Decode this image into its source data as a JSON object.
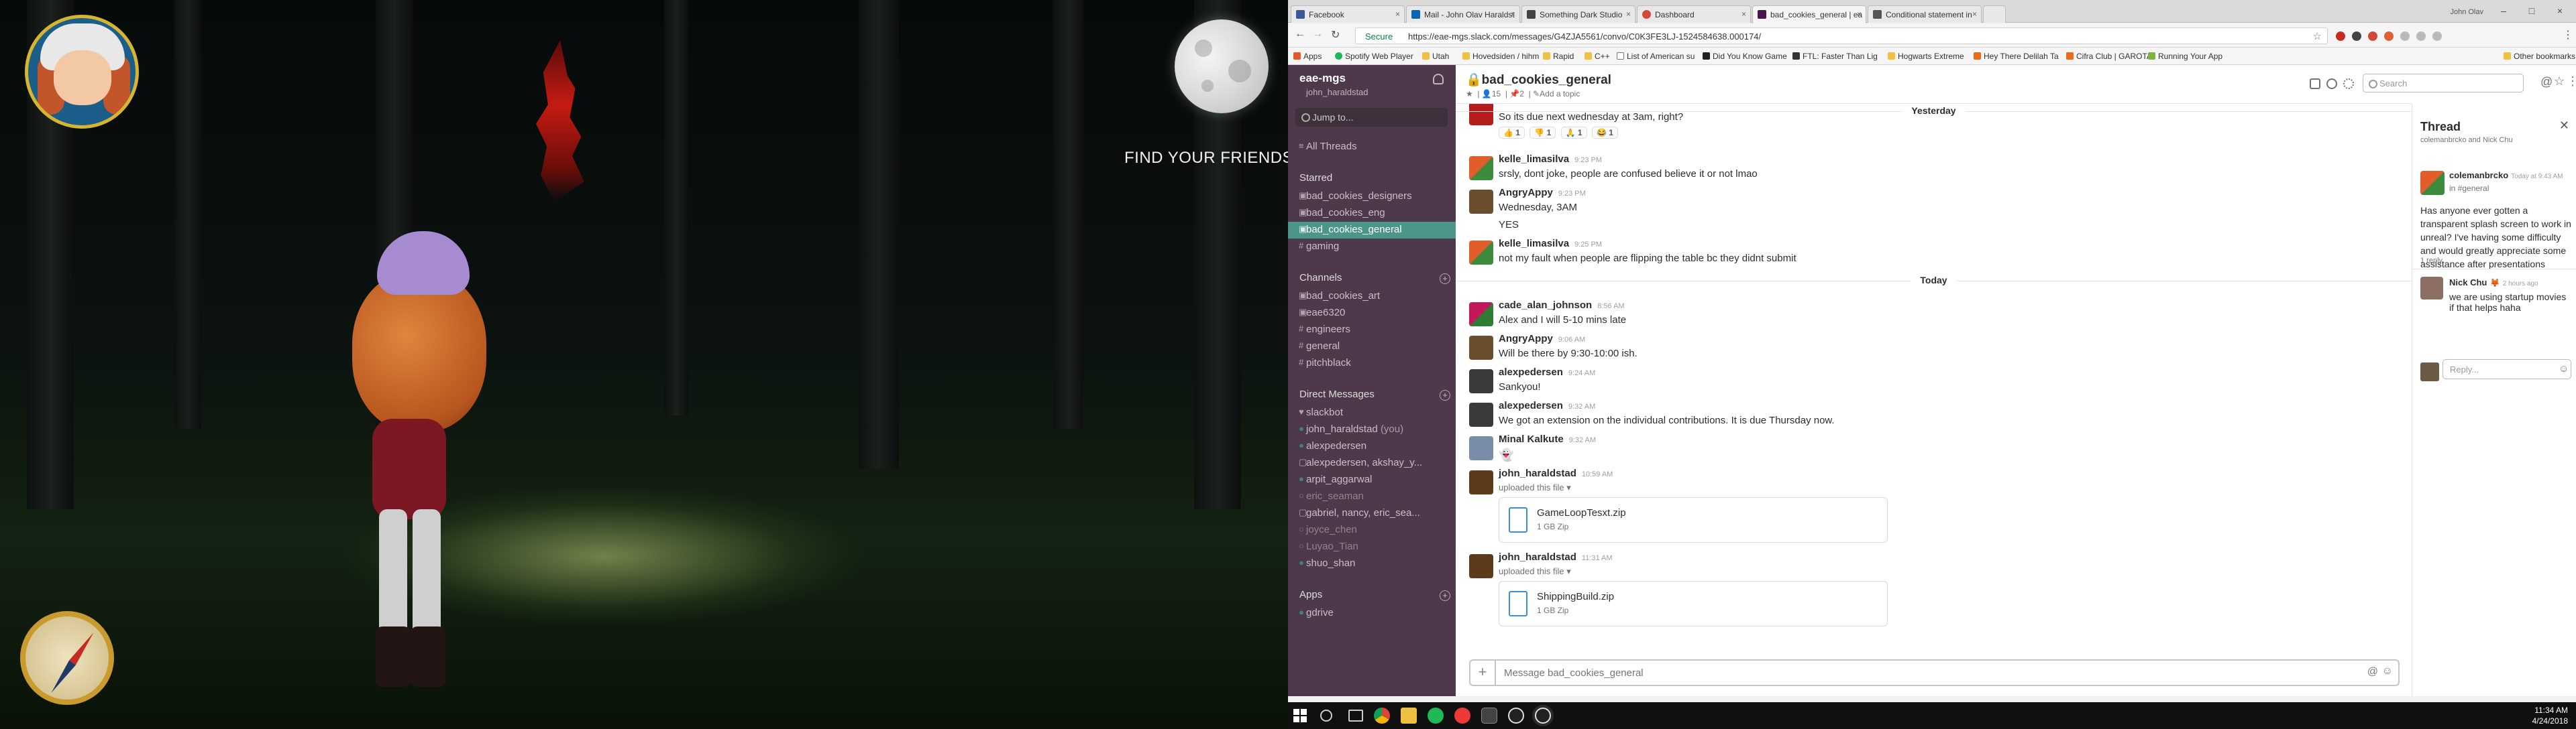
{
  "game": {
    "objective": "FIND YOUR FRIENDS"
  },
  "browser": {
    "tabs": [
      {
        "label": "Facebook",
        "color": "#3b5998"
      },
      {
        "label": "Mail - John Olav Haraldst",
        "color": "#0a64b4"
      },
      {
        "label": "Something Dark Studio",
        "color": "#444444"
      },
      {
        "label": "Dashboard",
        "color": "#d14836"
      },
      {
        "label": "bad_cookies_general | ea",
        "color": "#4a154b"
      },
      {
        "label": "Conditional statement in",
        "color": "#555555"
      }
    ],
    "window_user": "John Olav",
    "secure_label": "Secure",
    "url": "https://eae-mgs.slack.com/messages/G4ZJA5561/convo/C0K3FE3LJ-1524584638.000174/",
    "bookmarks": [
      "Apps",
      "Spotify Web Player",
      "Utah",
      "Hovedsiden / hihm",
      "Rapid",
      "C++",
      "List of American su",
      "Did You Know Game",
      "FTL: Faster Than Lig",
      "Hogwarts Extreme",
      "Hey There Delilah Ta",
      "Cifra Club | GAROTA",
      "Running Your App",
      "Other bookmarks"
    ]
  },
  "slack": {
    "team_name": "eae-mgs",
    "team_user": "john_haraldstad",
    "jump_to": "Jump to...",
    "all_threads": "All Threads",
    "starred_title": "Starred",
    "starred": [
      "bad_cookies_designers",
      "bad_cookies_eng",
      "bad_cookies_general",
      "gaming"
    ],
    "channels_title": "Channels",
    "channels": [
      "bad_cookies_art",
      "eae6320",
      "engineers",
      "general",
      "pitchblack"
    ],
    "dms_title": "Direct Messages",
    "dms": [
      "slackbot",
      "john_haraldstad",
      "alexpedersen",
      "alexpedersen, akshay_y...",
      "arpit_aggarwal",
      "eric_seaman",
      "gabriel, nancy, eric_sea...",
      "joyce_chen",
      "Luyao_Tian",
      "shuo_shan"
    ],
    "you_label": "(you)",
    "apps_title": "Apps",
    "apps": [
      "gdrive"
    ],
    "channel": {
      "name": "bad_cookies_general",
      "members": "15",
      "pins": "2",
      "topic": "Add a topic"
    },
    "search_placeholder": "Search",
    "day_yesterday": "Yesterday",
    "day_today": "Today",
    "messages": [
      {
        "author": "",
        "time": "",
        "text": "So its due next wednesday at 3am, right?",
        "reactions": [
          "1",
          "1",
          "1",
          "1"
        ]
      },
      {
        "author": "kelle_limasilva",
        "time": "9:23 PM",
        "text": "srsly, dont joke, people are confused believe it or not lmao"
      },
      {
        "author": "AngryAppy",
        "time": "9:23 PM",
        "text": "Wednesday, 3AM",
        "text2": "YES"
      },
      {
        "author": "kelle_limasilva",
        "time": "9:25 PM",
        "text": "not my fault when people are flipping the table bc they didnt submit"
      },
      {
        "author": "cade_alan_johnson",
        "time": "8:56 AM",
        "text": "Alex and I will 5-10 mins late"
      },
      {
        "author": "AngryAppy",
        "time": "9:06 AM",
        "text": "Will be there by 9:30-10:00 ish."
      },
      {
        "author": "alexpedersen",
        "time": "9:24 AM",
        "text": "Sankyou!"
      },
      {
        "author": "alexpedersen",
        "time": "9:32 AM",
        "text": "We got an extension on the individual contributions. It is due Thursday now."
      },
      {
        "author": "Minal Kalkute",
        "time": "9:32 AM",
        "text": ""
      },
      {
        "author": "john_haraldstad",
        "time": "10:59 AM",
        "text": "uploaded this file",
        "file": {
          "name": "GameLoopTesxt.zip",
          "meta": "1 GB Zip"
        }
      },
      {
        "author": "john_haraldstad",
        "time": "11:31 AM",
        "text": "uploaded this file",
        "file": {
          "name": "ShippingBuild.zip",
          "meta": "1 GB Zip"
        }
      }
    ],
    "composer_placeholder": "Message bad_cookies_general",
    "thread": {
      "title": "Thread",
      "subtitle": "colemanbrcko and Nick Chu",
      "author": "colemanbrcko",
      "time": "Today at 9:43 AM",
      "channel": "in #general",
      "text": "Has anyone ever gotten a transparent splash screen to work in unreal? I've having some difficulty and would greatly appreciate some assistance after presentations",
      "replies": "1 reply",
      "reply_author": "Nick Chu",
      "reply_time": "2 hours ago",
      "reply_text": "we are using startup movies if that helps haha",
      "reply_placeholder": "Reply..."
    }
  },
  "taskbar": {
    "time": "11:34 AM",
    "date": "4/24/2018"
  }
}
